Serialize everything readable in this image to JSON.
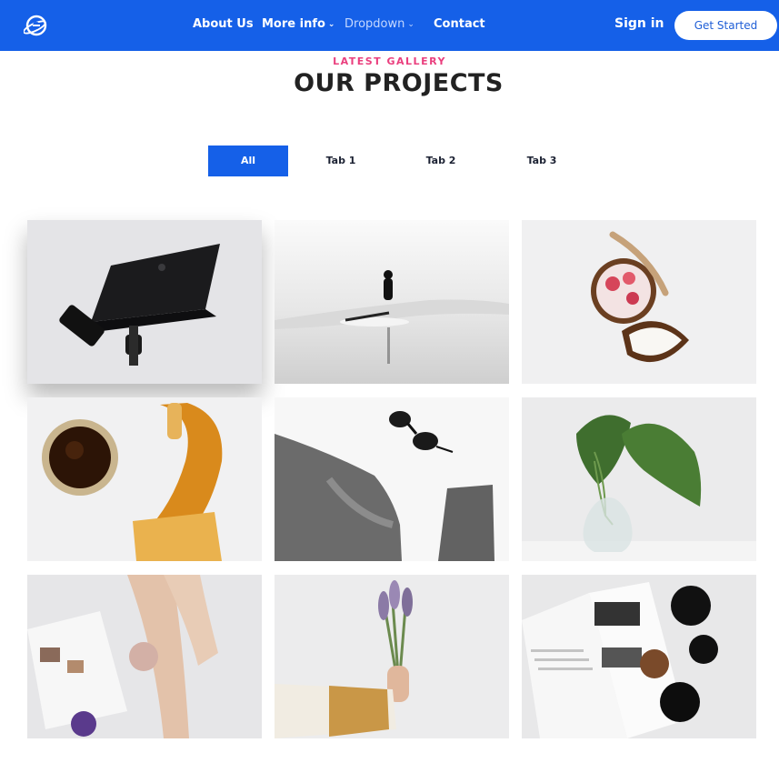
{
  "navbar": {
    "logo_icon": "orbit-logo-icon",
    "links": [
      {
        "label": "About Us",
        "dropdown": false
      },
      {
        "label": "More info",
        "dropdown": true
      },
      {
        "label": "Dropdown",
        "dropdown": true
      },
      {
        "label": "Contact",
        "dropdown": false
      }
    ],
    "signin_label": "Sign in",
    "cta_label": "Get Started"
  },
  "section": {
    "eyebrow": "LATEST GALLERY",
    "title": "OUR PROJECTS"
  },
  "tabs": [
    {
      "label": "All",
      "active": true
    },
    {
      "label": "Tab 1",
      "active": false
    },
    {
      "label": "Tab 2",
      "active": false
    },
    {
      "label": "Tab 3",
      "active": false
    }
  ],
  "gallery": [
    {
      "subject": "black laptop, phone and watch"
    },
    {
      "subject": "surfer on misty sea"
    },
    {
      "subject": "coconut bowl with strawberries"
    },
    {
      "subject": "honey jar and honeycomb"
    },
    {
      "subject": "grey sweater and sunglasses"
    },
    {
      "subject": "leaf in glass vase"
    },
    {
      "subject": "person reading magazine in bed"
    },
    {
      "subject": "lavender bouquet in hand"
    },
    {
      "subject": "open magazine with teapot and nuts"
    }
  ],
  "colors": {
    "brand": "#1560e8",
    "accent": "#ea3f7e",
    "text": "#222222"
  }
}
